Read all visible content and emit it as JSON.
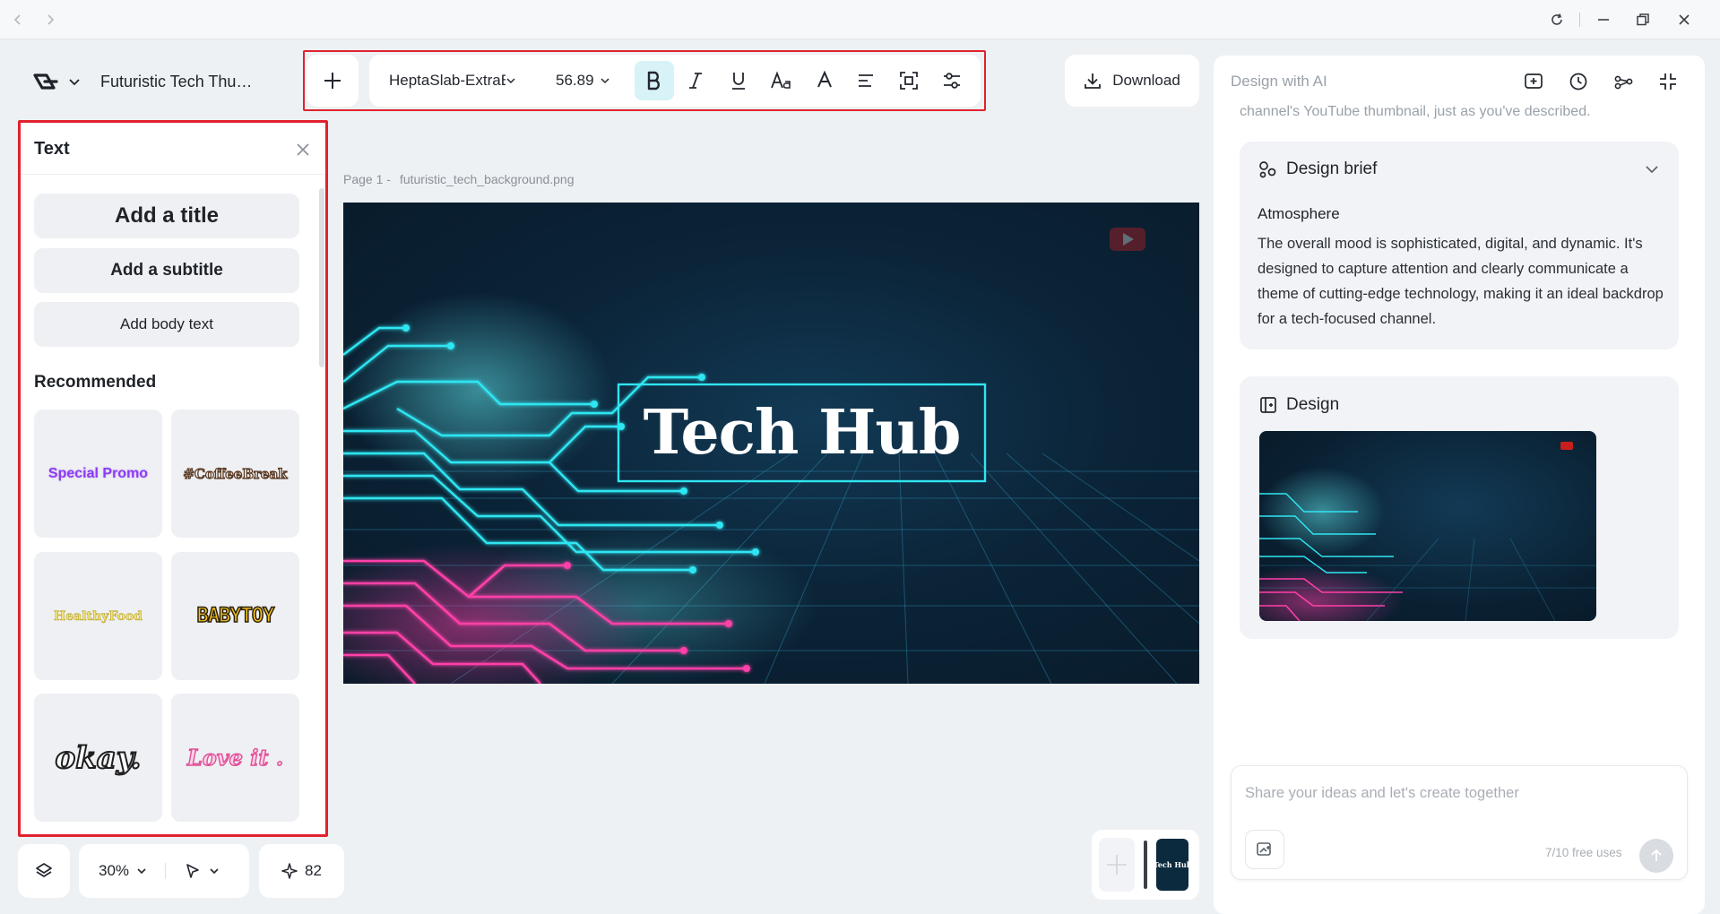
{
  "window": {
    "back_icon": "chevron-left-icon",
    "forward_icon": "chevron-right-icon",
    "refresh_icon": "refresh-icon",
    "minimize_icon": "minimize-icon",
    "restore_icon": "restore-icon",
    "close_icon": "close-icon"
  },
  "header": {
    "doc_title": "Futuristic Tech Thu…",
    "download_label": "Download"
  },
  "toolbar": {
    "font_family": "HeptaSlab-ExtraB",
    "font_size": "56.89",
    "bold_active": true
  },
  "text_panel": {
    "title": "Text",
    "add_title": "Add a title",
    "add_subtitle": "Add a subtitle",
    "add_body": "Add body text",
    "recommended_heading": "Recommended",
    "presets": [
      {
        "label": "Special Promo",
        "color": "#8a3cf0"
      },
      {
        "label": "#CoffeeBreak",
        "color": "#7a4a2e"
      },
      {
        "label": "HealthyFood",
        "color": "#e8d545"
      },
      {
        "label": "BABYTOY",
        "color": "#f4c21a"
      },
      {
        "label": "okay.",
        "color": "#ffffff"
      },
      {
        "label": "Love it .",
        "color": "#f06aa8"
      }
    ]
  },
  "canvas": {
    "page_label": "Page 1 -",
    "file_name": "futuristic_tech_background.png",
    "headline": "Tech Hub",
    "accent_cyan": "#2fe6f2",
    "accent_pink": "#ff3fa8"
  },
  "ai_panel": {
    "title": "Design with AI",
    "truncated_line": "channel's YouTube thumbnail, just as you've described.",
    "brief_title": "Design brief",
    "atmosphere_label": "Atmosphere",
    "atmosphere_text": "The overall mood is sophisticated, digital, and dynamic. It's designed to capture attention and clearly communicate a theme of cutting-edge technology, making it an ideal backdrop for a tech-focused channel.",
    "design_title": "Design",
    "input_placeholder": "Share your ideas and let's create together",
    "free_uses": "7/10 free uses"
  },
  "bottom_bar": {
    "zoom": "30%",
    "credits": "82"
  },
  "page_thumb": {
    "label": "Tech Hub"
  }
}
